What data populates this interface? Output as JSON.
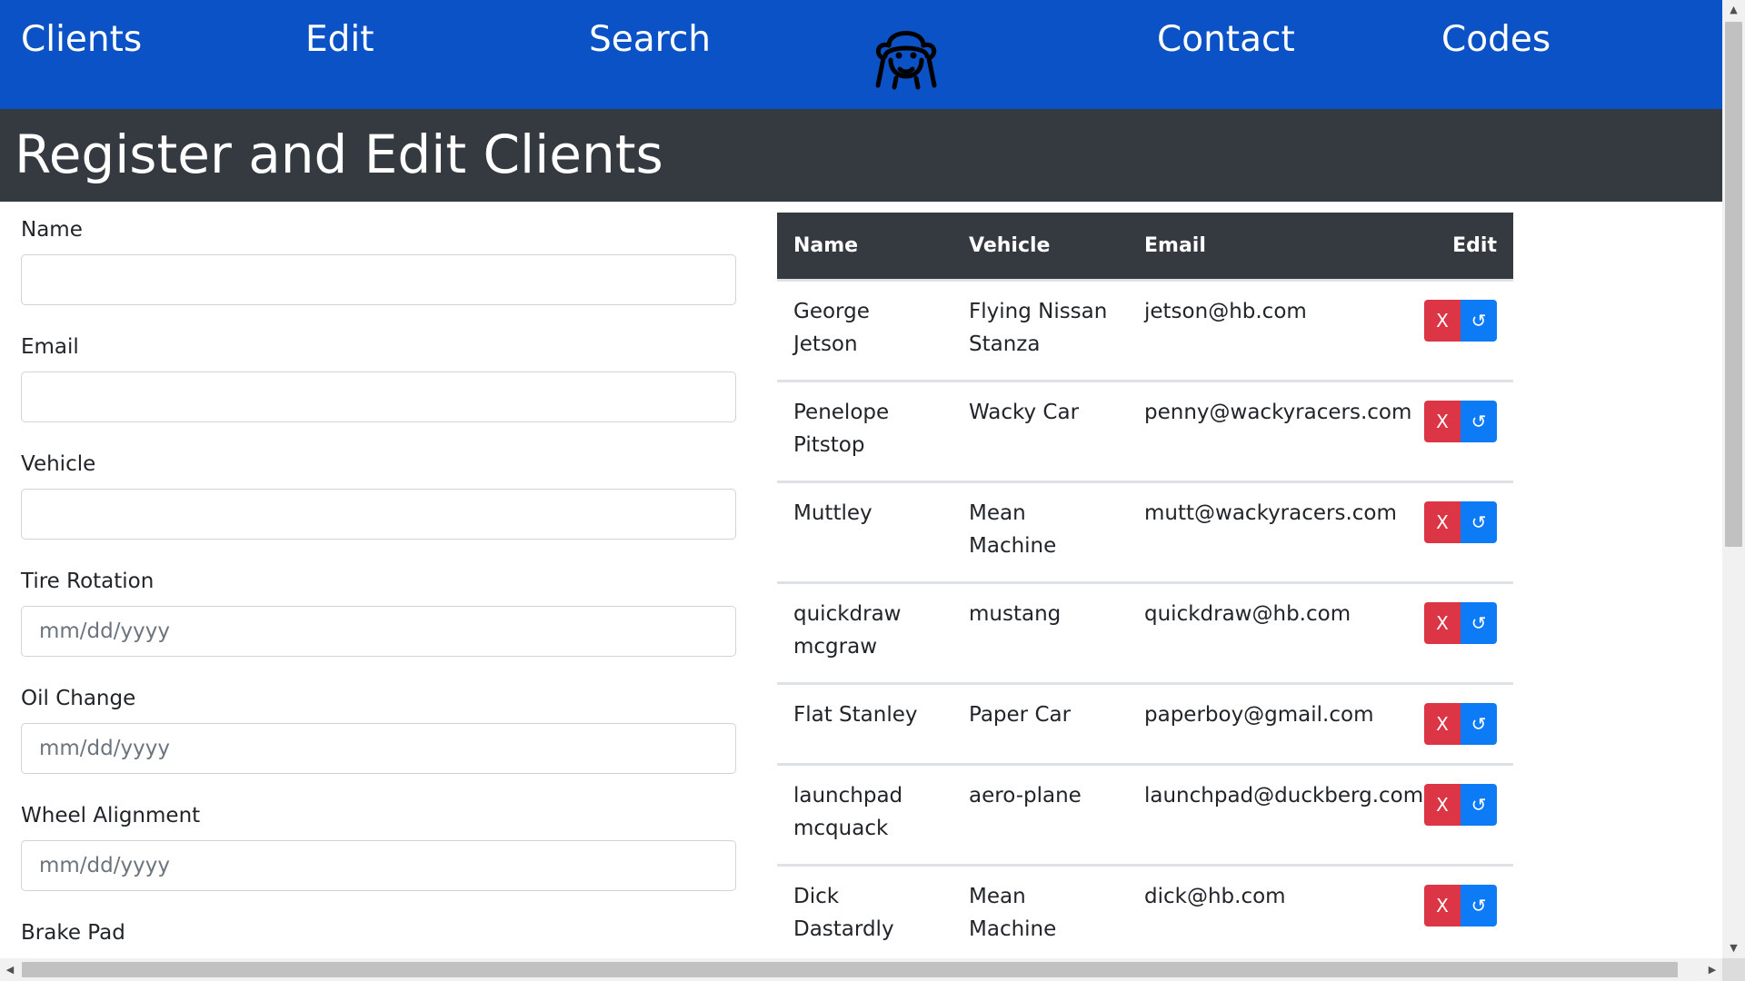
{
  "nav": {
    "items": [
      "Clients",
      "Edit",
      "Search",
      "Contact",
      "Codes"
    ],
    "logo_icon": "monkey-face-icon"
  },
  "header": {
    "title": "Register and Edit Clients"
  },
  "form": {
    "fields": [
      {
        "label": "Name",
        "value": "",
        "placeholder": ""
      },
      {
        "label": "Email",
        "value": "",
        "placeholder": ""
      },
      {
        "label": "Vehicle",
        "value": "",
        "placeholder": ""
      },
      {
        "label": "Tire Rotation",
        "value": "",
        "placeholder": "mm/dd/yyyy"
      },
      {
        "label": "Oil Change",
        "value": "",
        "placeholder": "mm/dd/yyyy"
      },
      {
        "label": "Wheel Alignment",
        "value": "",
        "placeholder": "mm/dd/yyyy"
      },
      {
        "label": "Brake Pad"
      }
    ]
  },
  "table": {
    "headers": [
      "Name",
      "Vehicle",
      "Email",
      "Edit"
    ],
    "rows": [
      {
        "name": "George Jetson",
        "vehicle": "Flying Nissan Stanza",
        "email": "jetson@hb.com"
      },
      {
        "name": "Penelope Pitstop",
        "vehicle": "Wacky Car",
        "email": "penny@wackyracers.com"
      },
      {
        "name": "Muttley",
        "vehicle": "Mean Machine",
        "email": "mutt@wackyracers.com"
      },
      {
        "name": "quickdraw mcgraw",
        "vehicle": "mustang",
        "email": "quickdraw@hb.com"
      },
      {
        "name": "Flat Stanley",
        "vehicle": "Paper Car",
        "email": "paperboy@gmail.com"
      },
      {
        "name": "launchpad mcquack",
        "vehicle": "aero-plane",
        "email": "launchpad@duckberg.com"
      },
      {
        "name": "Dick Dastardly",
        "vehicle": "Mean Machine",
        "email": "dick@hb.com"
      }
    ],
    "delete_label": "X",
    "update_label": "↺"
  },
  "colors": {
    "nav_bg": "#0b52c7",
    "header_bg": "#343a40",
    "delete": "#dc3545",
    "update": "#0d7bf5"
  }
}
